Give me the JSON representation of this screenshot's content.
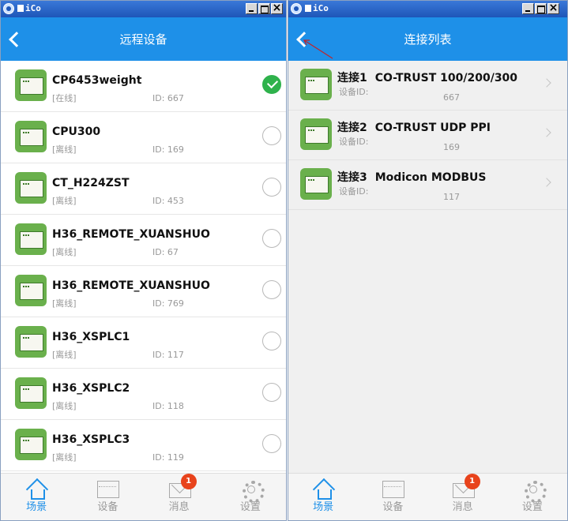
{
  "colors": {
    "accent": "#1e90e8",
    "checked": "#2fb24c",
    "device_icon": "#6ab04c",
    "badge": "#e8431c",
    "annotation": "#c0242a"
  },
  "left_window": {
    "title": "iCo",
    "header_title": "远程设备",
    "devices": [
      {
        "name": "CP6453weight",
        "status": "[在线]",
        "id": "ID:  667",
        "selected": true
      },
      {
        "name": "CPU300",
        "status": "[离线]",
        "id": "ID:  169",
        "selected": false
      },
      {
        "name": "CT_H224ZST",
        "status": "[离线]",
        "id": "ID:  453",
        "selected": false
      },
      {
        "name": "H36_REMOTE_XUANSHUO",
        "status": "[离线]",
        "id": "ID:  67",
        "selected": false
      },
      {
        "name": "H36_REMOTE_XUANSHUO",
        "status": "[离线]",
        "id": "ID:  769",
        "selected": false
      },
      {
        "name": "H36_XSPLC1",
        "status": "[离线]",
        "id": "ID:  117",
        "selected": false
      },
      {
        "name": "H36_XSPLC2",
        "status": "[离线]",
        "id": "ID:  118",
        "selected": false
      },
      {
        "name": "H36_XSPLC3",
        "status": "[离线]",
        "id": "ID:  119",
        "selected": false
      }
    ],
    "tabs": [
      {
        "label": "场景",
        "icon": "home-icon",
        "active": true
      },
      {
        "label": "设备",
        "icon": "device-icon",
        "active": false
      },
      {
        "label": "消息",
        "icon": "mail-icon",
        "active": false,
        "badge": "1"
      },
      {
        "label": "设置",
        "icon": "gear-icon",
        "active": false
      }
    ]
  },
  "right_window": {
    "title": "iCo",
    "header_title": "连接列表",
    "connections": [
      {
        "no": "连接1",
        "name": "CO-TRUST 100/200/300",
        "sub_label": "设备ID:",
        "id": "667"
      },
      {
        "no": "连接2",
        "name": "CO-TRUST UDP PPI",
        "sub_label": "设备ID:",
        "id": "169"
      },
      {
        "no": "连接3",
        "name": "Modicon MODBUS",
        "sub_label": "设备ID:",
        "id": "117"
      }
    ],
    "tabs": [
      {
        "label": "场景",
        "icon": "home-icon",
        "active": true
      },
      {
        "label": "设备",
        "icon": "device-icon",
        "active": false
      },
      {
        "label": "消息",
        "icon": "mail-icon",
        "active": false,
        "badge": "1"
      },
      {
        "label": "设置",
        "icon": "gear-icon",
        "active": false
      }
    ]
  }
}
